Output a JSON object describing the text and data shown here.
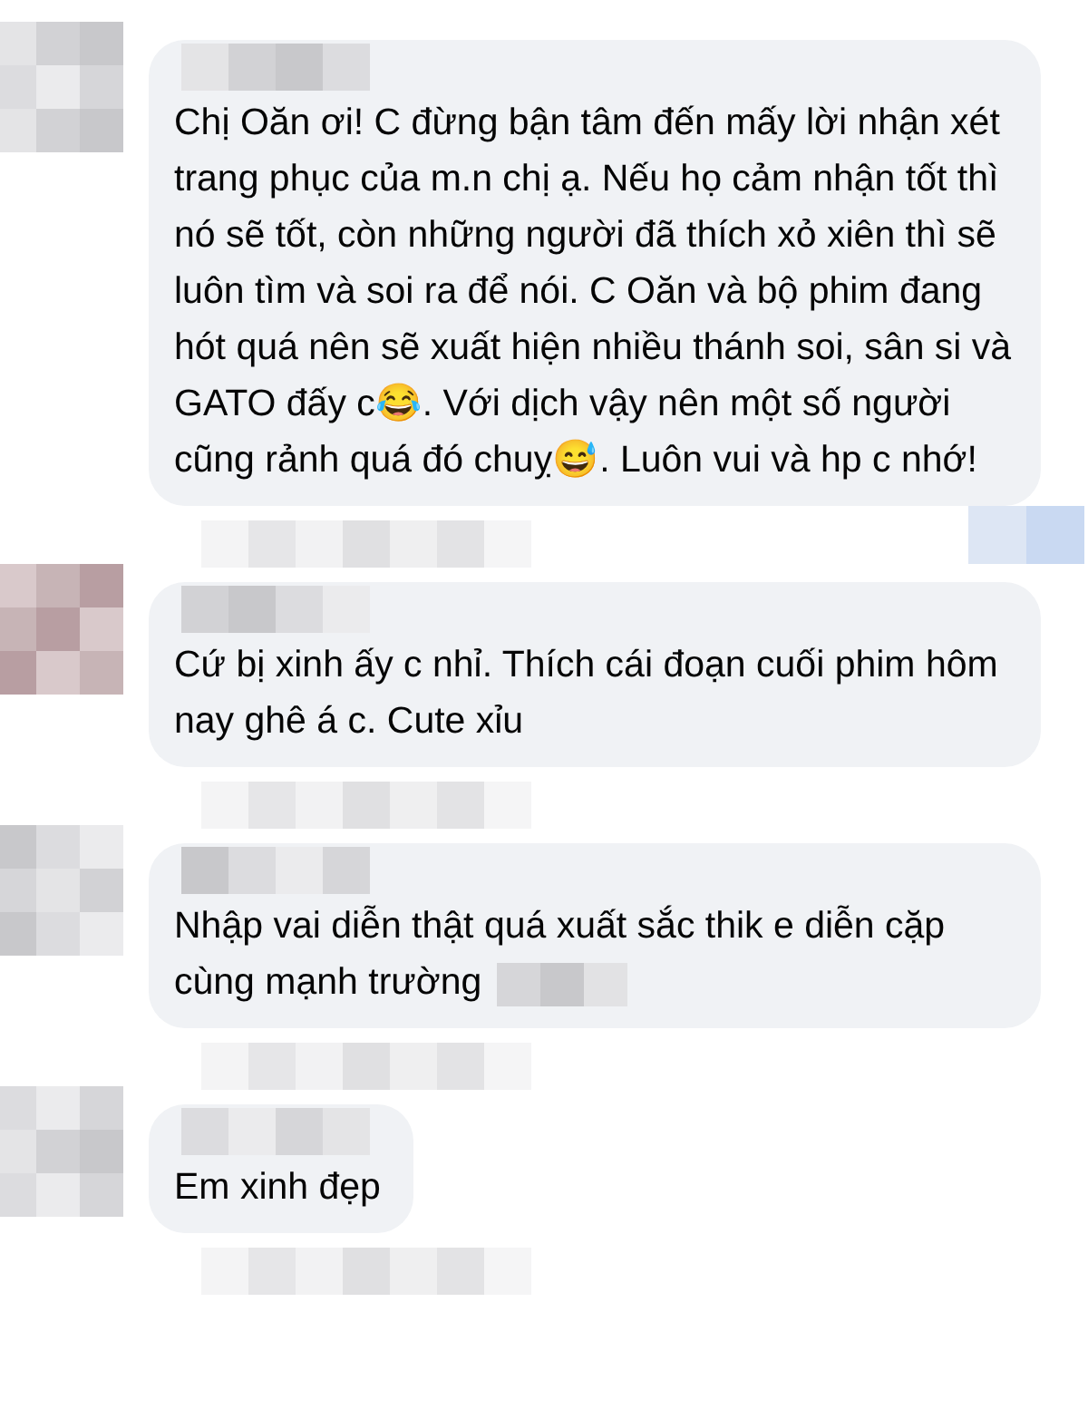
{
  "comments": [
    {
      "text": "Chị Oăn ơi! C đừng bận tâm đến mấy lời nhận xét trang phục của m.n chị ạ. Nếu họ cảm nhận tốt thì nó sẽ tốt, còn những người đã thích xỏ xiên thì sẽ luôn tìm và soi ra để nói. C Oăn và bộ phim đang hót quá nên sẽ xuất hiện nhiều thánh soi, sân si và GATO đấy c😂. Với dịch vậy nên một số người cũng rảnh quá đó chuỵ😅. Luôn vui và hp c nhớ!",
      "tagged": false,
      "reactions": true
    },
    {
      "text": "Cứ bị xinh ấy c nhỉ. Thích cái đoạn cuối phim hôm nay ghê á c. Cute xỉu",
      "tagged": false,
      "reactions": false
    },
    {
      "text": "Nhập vai diễn thật quá xuất sắc thik e diễn cặp cùng mạnh trường",
      "tagged": true,
      "reactions": false
    },
    {
      "text": "Em xinh đẹp",
      "tagged": false,
      "reactions": false
    }
  ]
}
